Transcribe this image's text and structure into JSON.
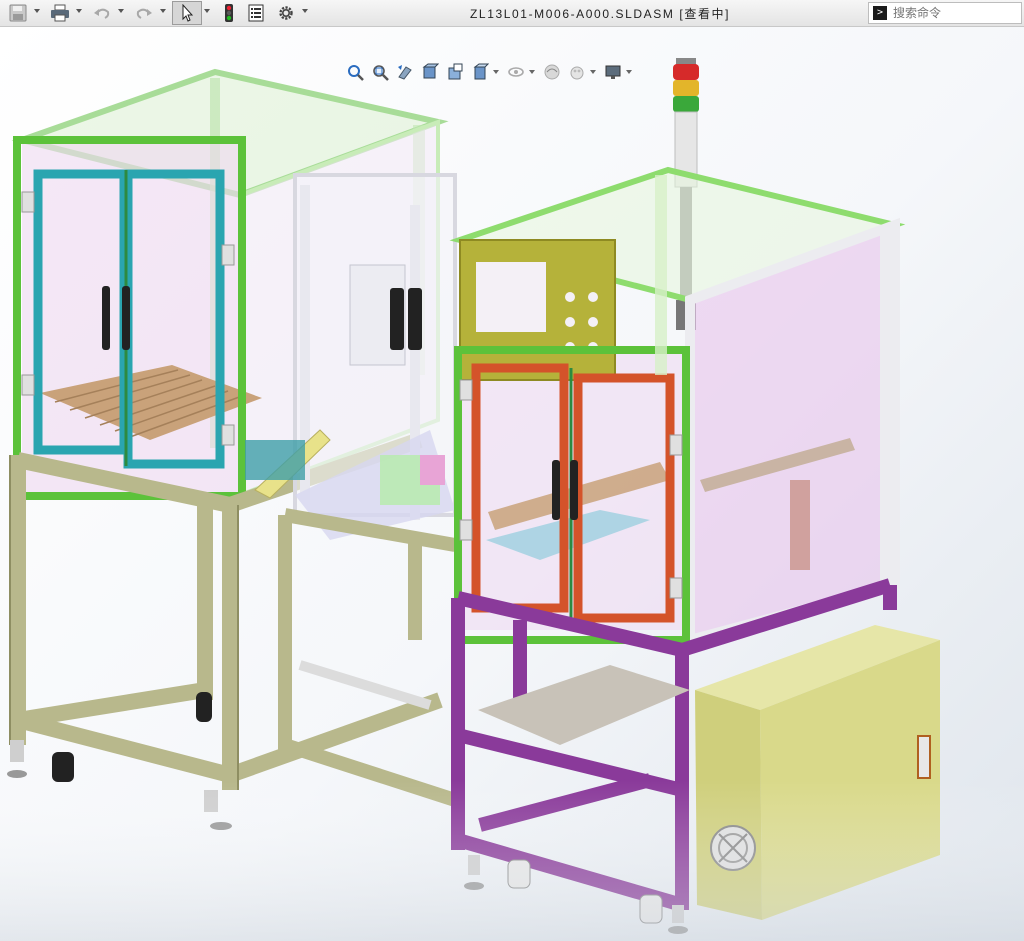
{
  "window": {
    "title": "ZL13L01-M006-A000.SLDASM [查看中]"
  },
  "toolbar": {
    "items": [
      {
        "name": "save",
        "icon": "save-icon"
      },
      {
        "name": "print",
        "icon": "print-icon"
      },
      {
        "name": "undo",
        "icon": "undo-icon"
      },
      {
        "name": "redo",
        "icon": "redo-icon"
      },
      {
        "name": "select",
        "icon": "cursor-icon"
      },
      {
        "name": "rebuild",
        "icon": "traffic-light-icon"
      },
      {
        "name": "file-properties",
        "icon": "properties-icon"
      },
      {
        "name": "options",
        "icon": "gear-icon"
      }
    ]
  },
  "search": {
    "placeholder": "搜索命令"
  },
  "heads_up": {
    "items": [
      {
        "name": "zoom-to-fit",
        "icon": "zoom-fit-icon"
      },
      {
        "name": "zoom-to-area",
        "icon": "zoom-area-icon"
      },
      {
        "name": "previous-view",
        "icon": "previous-view-icon"
      },
      {
        "name": "section-view",
        "icon": "section-view-icon"
      },
      {
        "name": "dynamic-annotation",
        "icon": "annotation-view-icon"
      },
      {
        "name": "view-orientation",
        "icon": "view-orientation-icon"
      },
      {
        "name": "display-style",
        "icon": "display-style-icon"
      },
      {
        "name": "hide-show",
        "icon": "hide-show-icon"
      },
      {
        "name": "edit-appearance",
        "icon": "appearance-icon"
      },
      {
        "name": "apply-scene",
        "icon": "scene-icon"
      },
      {
        "name": "view-settings",
        "icon": "monitor-icon"
      }
    ]
  },
  "model": {
    "label_on_cabinet": "",
    "colors": {
      "frame_khaki": "#b8b88c",
      "frame_purple": "#8a3a9a",
      "door_teal": "#2aa5b0",
      "door_orange": "#d4532a",
      "profile_green": "#5cc23a",
      "panel_olive": "#b5b23a",
      "cabinet_yellow": "#d9d98a",
      "glass_pink": "#e8c8ec"
    }
  }
}
